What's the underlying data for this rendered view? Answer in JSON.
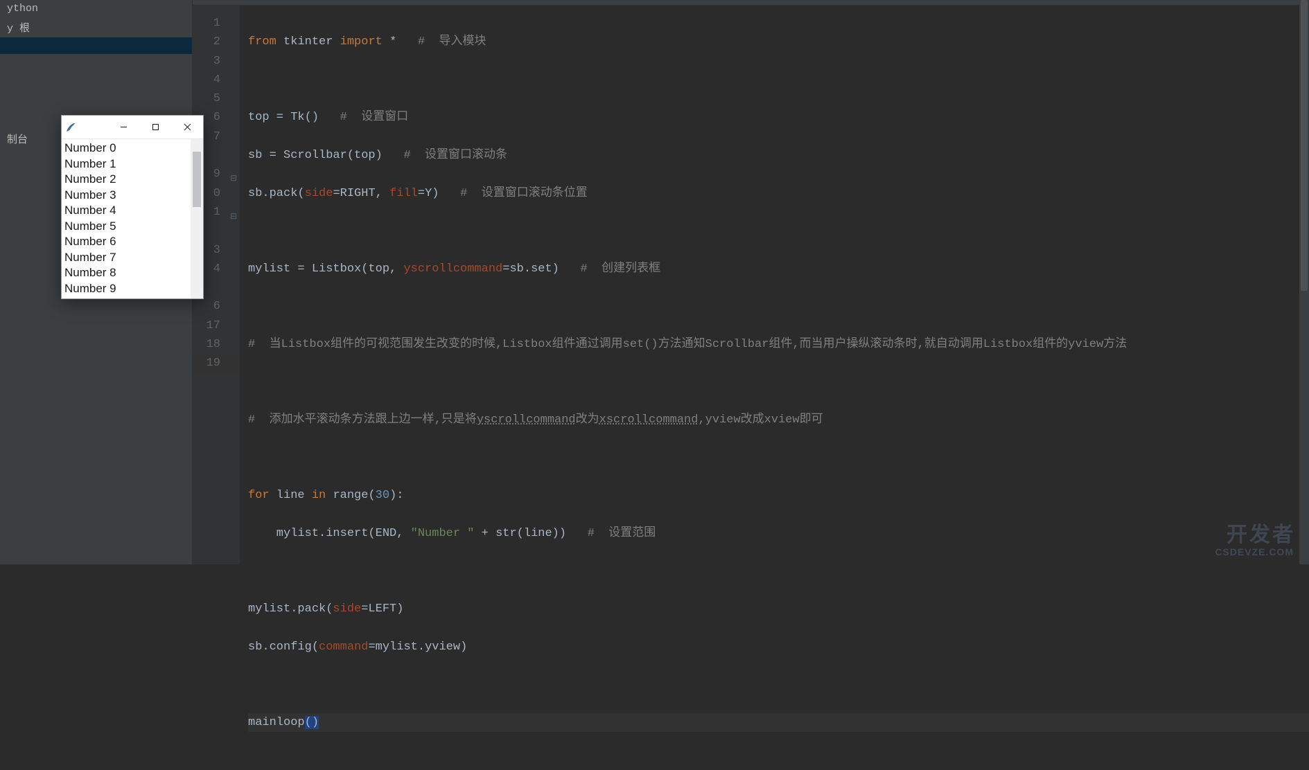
{
  "sidebar": {
    "items": [
      "ython",
      "y 根"
    ],
    "selected_blank": "",
    "tool_label": "制台"
  },
  "tk_window": {
    "icon": "tk-feather-icon",
    "items": [
      "Number 0",
      "Number 1",
      "Number 2",
      "Number 3",
      "Number 4",
      "Number 5",
      "Number 6",
      "Number 7",
      "Number 8",
      "Number 9"
    ]
  },
  "editor": {
    "line_numbers": [
      "1",
      "2",
      "3",
      "4",
      "5",
      "6",
      "7",
      "9",
      "0",
      "1",
      "3",
      "4",
      "6",
      "17",
      "18",
      "19"
    ],
    "code": {
      "l1": {
        "a": "from",
        "b": "tkinter",
        "c": "import",
        "d": "*",
        "e": "#  导入模块"
      },
      "l3": {
        "a": "top = Tk()",
        "b": "#  设置窗口"
      },
      "l4": {
        "a": "sb = Scrollbar(top)",
        "b": "#  设置窗口滚动条"
      },
      "l5": {
        "a": "sb.pack(",
        "b": "side",
        "c": "=RIGHT, ",
        "d": "fill",
        "e": "=Y)",
        "f": "#  设置窗口滚动条位置"
      },
      "l7": {
        "a": "mylist = Listbox(top, ",
        "b": "yscrollcommand",
        "c": "=sb.set)",
        "d": "#  创建列表框"
      },
      "l9": {
        "a": "#  当Listbox组件的可视范围发生改变的时候,Listbox组件通过调用set()方法通知Scrollbar组件,而当用户操纵滚动条时,就自动调用Listbox组件的yview方法"
      },
      "l11": {
        "a": "#  添加水平滚动条方法跟上边一样,只是将",
        "b": "yscrollcommand",
        "c": "改为",
        "d": "xscrollcommand",
        "e": ",yview改成xview即可"
      },
      "l13": {
        "a": "for",
        "b": "line",
        "c": "in",
        "d": "range",
        "e": "(",
        "f": "30",
        "g": "):"
      },
      "l14": {
        "a": "    mylist.insert(END, ",
        "b": "\"Number \"",
        "c": " + str(line))",
        "d": "#  设置范围"
      },
      "l16": {
        "a": "mylist.pack(",
        "b": "side",
        "c": "=LEFT)"
      },
      "l17": {
        "a": "sb.config(",
        "b": "command",
        "c": "=mylist.yview)"
      },
      "l19": {
        "a": "mainloop",
        "b": "()"
      }
    }
  },
  "watermark": {
    "big": "开发者",
    "small": "CSDEVZE.COM"
  }
}
